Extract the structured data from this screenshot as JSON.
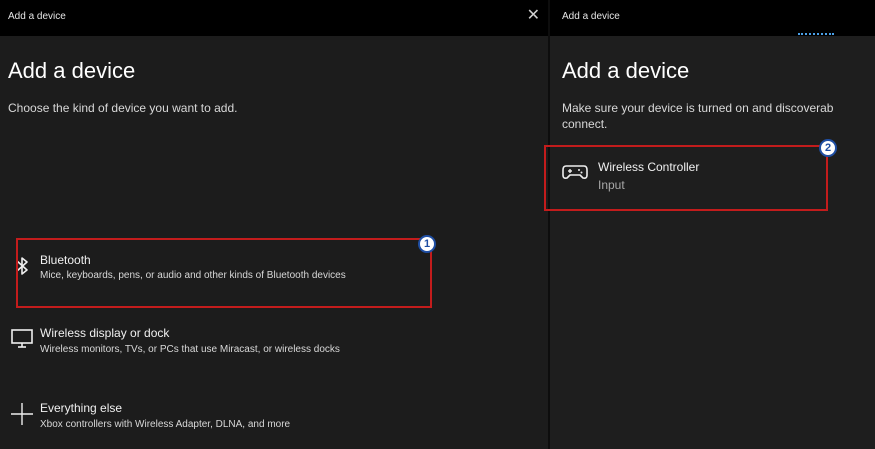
{
  "left_window": {
    "title": "Add a device",
    "close_glyph": "✕",
    "heading": "Add a device",
    "subtitle": "Choose the kind of device you want to add.",
    "options": [
      {
        "icon": "bluetooth-icon",
        "title": "Bluetooth",
        "description": "Mice, keyboards, pens, or audio and other kinds of Bluetooth devices"
      },
      {
        "icon": "monitor-icon",
        "title": "Wireless display or dock",
        "description": "Wireless monitors, TVs, or PCs that use Miracast, or wireless docks"
      },
      {
        "icon": "plus-icon",
        "title": "Everything else",
        "description": "Xbox controllers with Wireless Adapter, DLNA, and more"
      }
    ]
  },
  "right_window": {
    "title": "Add a device",
    "heading": "Add a device",
    "subtitle": "Make sure your device is turned on and discoverab\nconnect.",
    "devices": [
      {
        "icon": "gamepad-icon",
        "name": "Wireless Controller",
        "type": "Input"
      }
    ]
  },
  "annotations": [
    {
      "label": "1",
      "color": "#c31c1c"
    },
    {
      "label": "2",
      "color": "#c31c1c"
    }
  ]
}
